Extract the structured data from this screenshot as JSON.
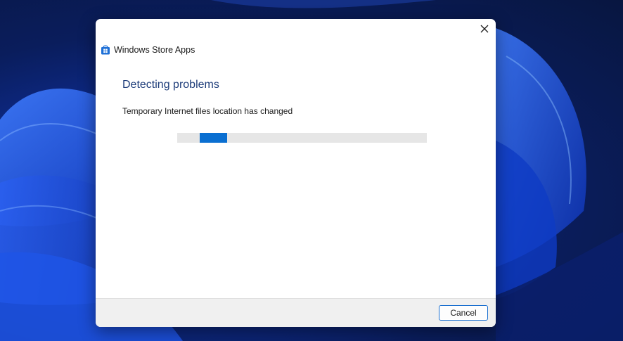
{
  "window": {
    "title": "Windows Store Apps",
    "app_icon": "store-bag-icon",
    "close_icon": "close-icon"
  },
  "main": {
    "heading": "Detecting problems",
    "status": "Temporary Internet files location has changed",
    "progress": {
      "mode": "indeterminate",
      "segment_position_fraction": 0.09
    }
  },
  "footer": {
    "cancel_label": "Cancel"
  },
  "colors": {
    "accent": "#0a6fd1",
    "heading": "#1e3d7a",
    "footer_bg": "#f0f0f0",
    "progress_track": "#e6e6e6"
  }
}
